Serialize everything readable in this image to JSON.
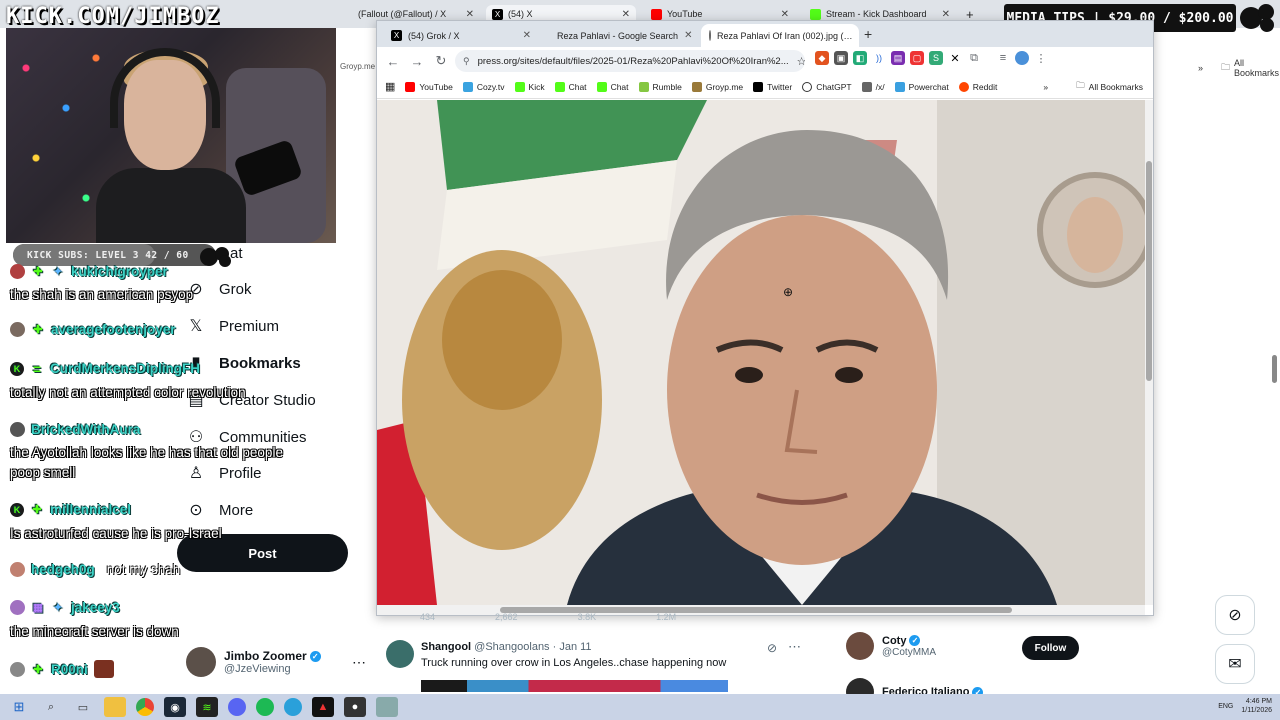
{
  "background_tabs": [
    {
      "label": "(Fallout (@Fallout) / X",
      "icon": "x-logo-icon"
    },
    {
      "label": "(54) X",
      "icon": "x-logo-icon"
    },
    {
      "label": "YouTube",
      "icon": "youtube-icon"
    },
    {
      "label": "Stream - Kick Dashboard",
      "icon": "kick-icon"
    }
  ],
  "right_bookmark": "All Bookmarks",
  "groyp_partial": "Groyp.me",
  "stream_overlay": {
    "channel_url": "KICK.COM/JIMBOZ",
    "sub_goal": {
      "label": "KICK SUBS: LEVEL 3",
      "current": 42,
      "target": 60,
      "text": "42 / 60"
    },
    "media_tips": "MEDIA TIPS | $29.00 / $200.00"
  },
  "x_nav": {
    "items": [
      {
        "label": "at",
        "icon": "chat-icon"
      },
      {
        "label": "Grok",
        "icon": "grok-icon"
      },
      {
        "label": "Premium",
        "icon": "x-logo-icon"
      },
      {
        "label": "Bookmarks",
        "icon": "bookmark-icon"
      },
      {
        "label": "Creator Studio",
        "icon": "creator-studio-icon"
      },
      {
        "label": "Communities",
        "icon": "communities-icon"
      },
      {
        "label": "Profile",
        "icon": "profile-icon"
      },
      {
        "label": "More",
        "icon": "more-circle-icon"
      }
    ],
    "post_label": "Post",
    "account": {
      "name": "Jimbo Zoomer",
      "handle": "@JzeViewing"
    }
  },
  "chat": [
    {
      "user": "kukichigroyper",
      "message": "the shah is an american psyop"
    },
    {
      "user": "averagefootenjoyer",
      "message": ""
    },
    {
      "user": "CurdMerkensDiplingFH",
      "message": "totally not an attempted color revolution"
    },
    {
      "user": "BrickedWithAura",
      "message": "the Ayotollah looks like he has that old people"
    },
    {
      "user": "",
      "message": "poop smell"
    },
    {
      "user": "millennialcel",
      "message": "Is astroturfed cause he is pro-Israel"
    },
    {
      "user": "hedgeh0g",
      "message": "not my shah"
    },
    {
      "user": "jakeey3",
      "message": "the minecraft server is down"
    },
    {
      "user": "R00ni",
      "message": ""
    }
  ],
  "browser": {
    "tabs": [
      {
        "label": "(54) Grok / X",
        "icon": "x-logo-icon",
        "active": false
      },
      {
        "label": "Reza Pahlavi - Google Search",
        "icon": "google-icon",
        "active": false
      },
      {
        "label": "Reza Pahlavi Of Iran (002).jpg (…",
        "icon": "globe-icon",
        "active": true
      }
    ],
    "url": "press.org/sites/default/files/2025-01/Reza%20Pahlavi%20Of%20Iran%2...",
    "bookmarks": [
      "YouTube",
      "Cozy.tv",
      "Kick",
      "Chat",
      "Chat",
      "Rumble",
      "Groyp.me",
      "Twitter",
      "ChatGPT",
      "/x/",
      "Powerchat",
      "Reddit"
    ],
    "all_bookmarks": "All Bookmarks",
    "horizontal_scroll": 0.16,
    "vertical_scroll": 0.12
  },
  "feed": {
    "tweet": {
      "name": "Shangool",
      "handle": "@Shangoolans",
      "date": "· Jan 11",
      "text": "Truck running over crow in Los Angeles..chase happening now"
    },
    "metric_ghosts": [
      "434",
      "2,662",
      "3.8K",
      "1.2M"
    ]
  },
  "who_to_follow": [
    {
      "name": "Coty",
      "handle": "@CotyMMA",
      "button": "Follow"
    },
    {
      "name": "Federico Italiano",
      "handle": "",
      "button": ""
    }
  ],
  "taskbar": {
    "lang": "ENG",
    "time": "4:46 PM",
    "date": "1/11/2026"
  }
}
